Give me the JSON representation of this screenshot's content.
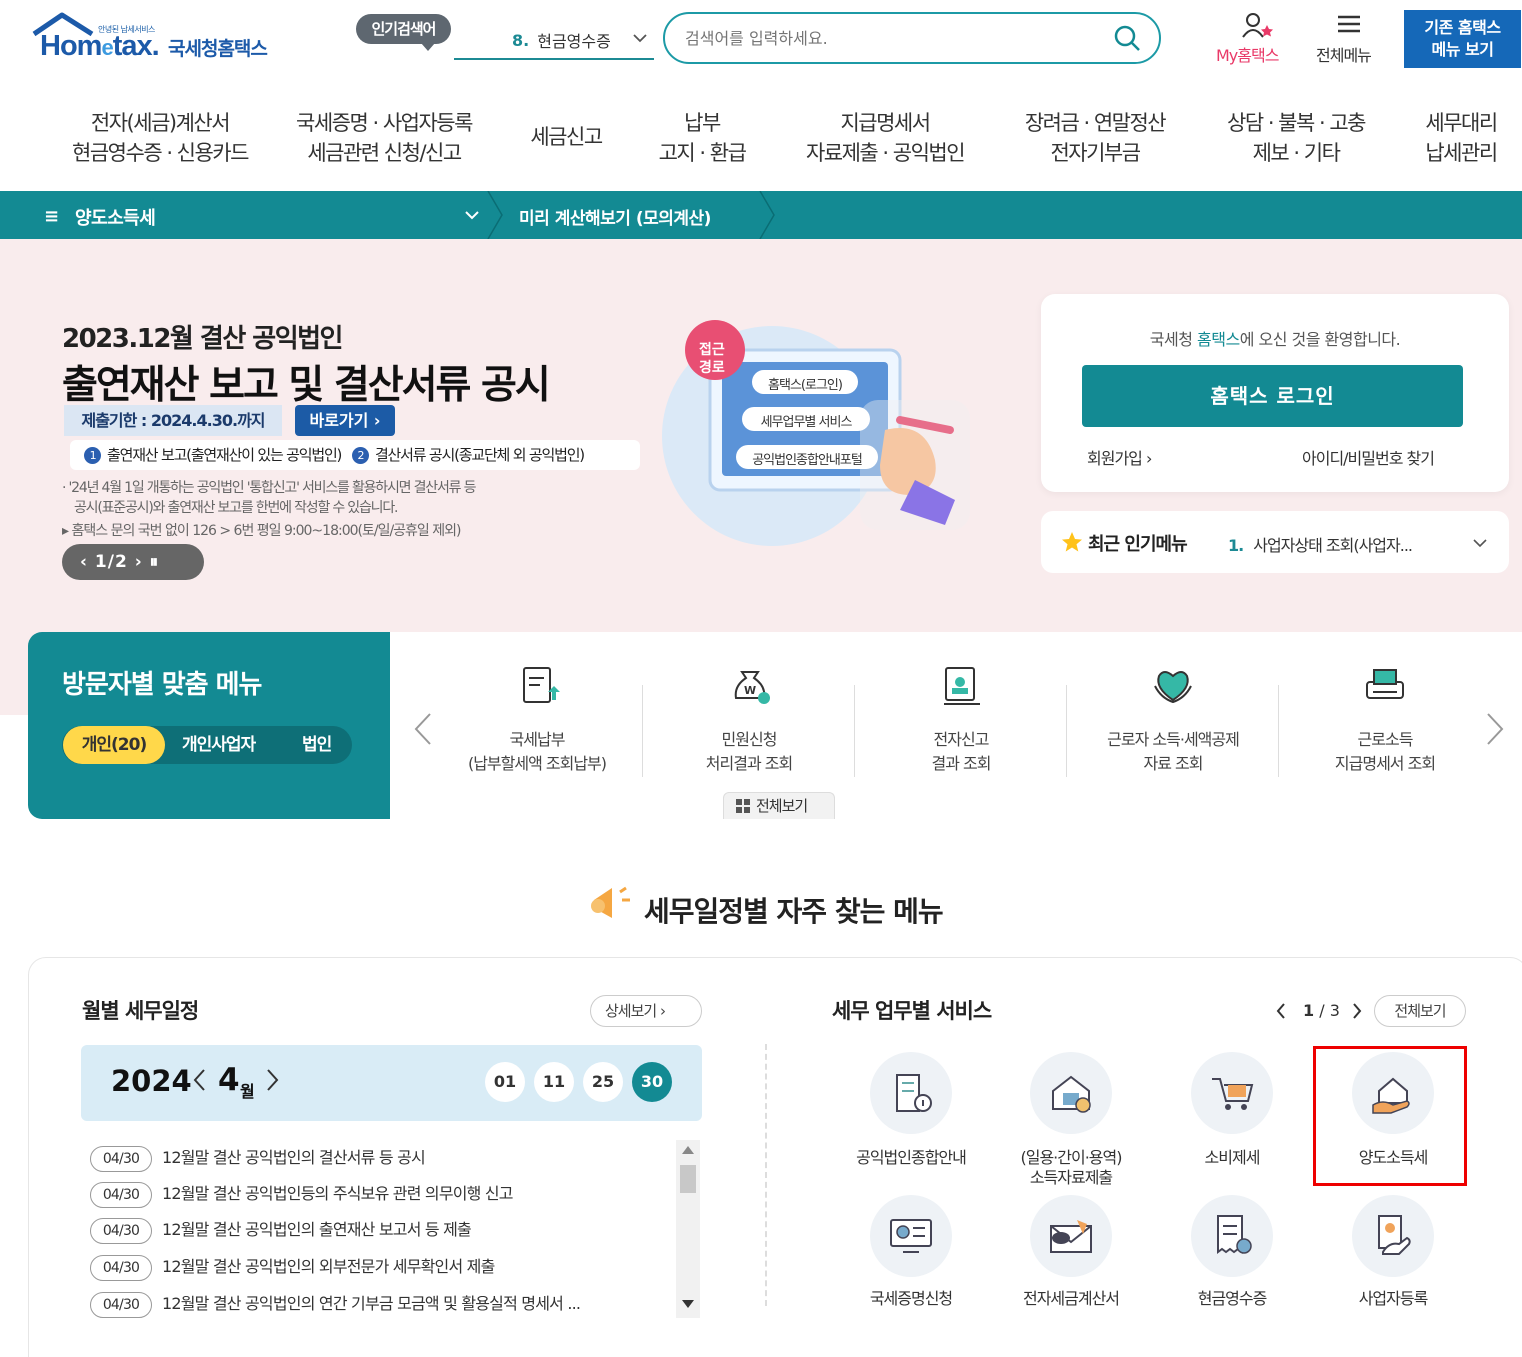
{
  "header": {
    "logo_small": "안녕된 납세서비스",
    "logo_text_a": "Hom",
    "logo_text_b": "e",
    "logo_text_c": "tax.",
    "logo_ko": "국세청홈택스",
    "popular_badge": "인기검색어",
    "popular_rank": "8.",
    "popular_term": "현금영수증",
    "search_placeholder": "검색어를 입력하세요.",
    "my_hometax": "My홈택스",
    "all_menu": "전체메뉴",
    "old_menu_line1": "기존 홈택스",
    "old_menu_line2": "메뉴 보기"
  },
  "gnb": [
    {
      "line1": "전자(세금)계산서",
      "line2": "현금영수증 · 신용카드"
    },
    {
      "line1": "국세증명 · 사업자등록",
      "line2": "세금관련 신청/신고"
    },
    {
      "line1": "세금신고",
      "line2": ""
    },
    {
      "line1": "납부",
      "line2": "고지 · 환급"
    },
    {
      "line1": "지급명세서",
      "line2": "자료제출 · 공익법인"
    },
    {
      "line1": "장려금 · 연말정산",
      "line2": "전자기부금"
    },
    {
      "line1": "상담 · 불복 · 고충",
      "line2": "제보 · 기타"
    },
    {
      "line1": "세무대리",
      "line2": "납세관리"
    }
  ],
  "breadcrumb": {
    "menu_icon": "≡",
    "selected": "양도소득세",
    "simulation": "미리 계산해보기 (모의계산)"
  },
  "banner": {
    "subtitle": "2023.12월 결산 공익법인",
    "title": "출연재산 보고 및 결산서류 공시",
    "deadline": "제출기한 : 2024.4.30.까지",
    "go_button": "바로가기 ›",
    "point1_num": "1",
    "point1": "출연재산 보고(출연재산이 있는 공익법인)",
    "point2_num": "2",
    "point2": "결산서류 공시(종교단체 외 공익법인)",
    "note_line1": "· '24년 4월 1일 개통하는 공익법인 '통합신고' 서비스를 활용하시면 결산서류 등",
    "note_line2": "공시(표준공시)와 출연재산 보고를 한번에 작성할 수 있습니다.",
    "phone": "▸ 홈택스 문의 국번 없이 126 > 6번 평일 9:00~18:00(토/일/공휴일 제외)",
    "pager": "‹  1/2  ›   ⏸",
    "ill_badge_1": "접근",
    "ill_badge_2": "경로",
    "ill_step1": "홈택스(로그인)",
    "ill_step2": "세무업무별 서비스",
    "ill_step3": "공익법인종합안내포털"
  },
  "login": {
    "welcome_a": "국세청 ",
    "welcome_hl": "홈택스",
    "welcome_b": "에 오신 것을 환영합니다.",
    "login_button": "홈택스 로그인",
    "join": "회원가입 ›",
    "find": "아이디/비밀번호 찾기",
    "popular_label": "최근 인기메뉴",
    "popular_num": "1.",
    "popular_item": "사업자상태 조회(사업자..."
  },
  "visitor": {
    "title": "방문자별 맞춤 메뉴",
    "tabs": [
      "개인(20)",
      "개인사업자",
      "법인"
    ],
    "items": [
      {
        "line1": "국세납부",
        "line2": "(납부할세액 조회납부)"
      },
      {
        "line1": "민원신청",
        "line2": "처리결과 조회"
      },
      {
        "line1": "전자신고",
        "line2": "결과 조회"
      },
      {
        "line1": "근로자 소득·세액공제",
        "line2": "자료 조회"
      },
      {
        "line1": "근로소득",
        "line2": "지급명세서 조회"
      }
    ],
    "view_all": "전체보기"
  },
  "section_title": "세무일정별 자주 찾는 메뉴",
  "calendar": {
    "title": "월별 세무일정",
    "detail": "상세보기 ›",
    "year": "2024",
    "month": "4",
    "month_suffix": "월",
    "days": [
      "01",
      "11",
      "25",
      "30"
    ],
    "selected_day": "30",
    "schedule": [
      {
        "date": "04/30",
        "text": "12월말 결산 공익법인의 결산서류 등 공시"
      },
      {
        "date": "04/30",
        "text": "12월말 결산 공익법인등의 주식보유 관련 의무이행 신고"
      },
      {
        "date": "04/30",
        "text": "12월말 결산 공익법인의 출연재산 보고서 등 제출"
      },
      {
        "date": "04/30",
        "text": "12월말 결산 공익법인의 외부전문가 세무확인서 제출"
      },
      {
        "date": "04/30",
        "text": "12월말 결산 공익법인의 연간 기부금 모금액 및 활용실적 명세서 ..."
      }
    ]
  },
  "services": {
    "title": "세무 업무별 서비스",
    "page_current": "1",
    "page_total": "3",
    "view_all": "전체보기",
    "items": [
      {
        "label": "공익법인종합안내",
        "label2": "",
        "icon": "building-info-icon"
      },
      {
        "label": "(일용·간이·용역)",
        "label2": "소득자료제출",
        "icon": "house-money-icon"
      },
      {
        "label": "소비제세",
        "label2": "",
        "icon": "cart-icon"
      },
      {
        "label": "양도소득세",
        "label2": "",
        "icon": "house-hand-icon"
      },
      {
        "label": "국세증명신청",
        "label2": "",
        "icon": "certificate-monitor-icon"
      },
      {
        "label": "전자세금계산서",
        "label2": "",
        "icon": "tax-envelope-icon"
      },
      {
        "label": "현금영수증",
        "label2": "",
        "icon": "receipt-coin-icon"
      },
      {
        "label": "사업자등록",
        "label2": "",
        "icon": "document-hand-icon"
      }
    ]
  },
  "colors": {
    "teal": "#138a93",
    "brand_blue": "#1c5aa9",
    "highlight": "#e00000"
  }
}
